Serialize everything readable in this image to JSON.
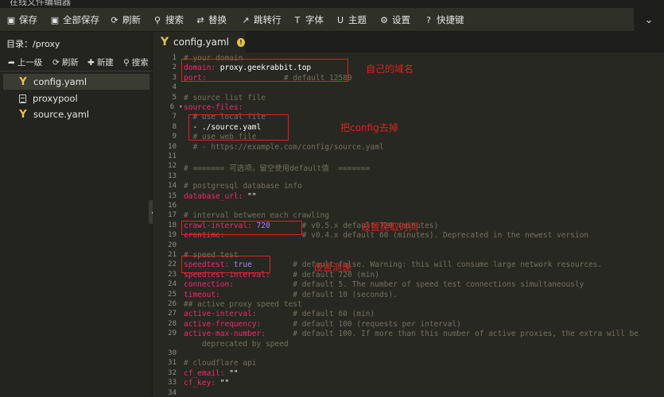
{
  "window": {
    "title": "在线文件编辑器"
  },
  "toolbar": {
    "items": [
      {
        "label": "保存",
        "icon": "save-icon",
        "glyph": "▣"
      },
      {
        "label": "全部保存",
        "icon": "save-all-icon",
        "glyph": "▣"
      },
      {
        "label": "刷新",
        "icon": "refresh-icon",
        "glyph": "⟳"
      },
      {
        "label": "搜索",
        "icon": "search-icon",
        "glyph": "⚲"
      },
      {
        "label": "替换",
        "icon": "replace-icon",
        "glyph": "⇄"
      },
      {
        "label": "跳转行",
        "icon": "goto-line-icon",
        "glyph": "↗"
      },
      {
        "label": "字体",
        "icon": "font-icon",
        "glyph": "T"
      },
      {
        "label": "主题",
        "icon": "theme-icon",
        "glyph": "U"
      },
      {
        "label": "设置",
        "icon": "gear-icon",
        "glyph": "⚙"
      },
      {
        "label": "快捷键",
        "icon": "help-icon",
        "glyph": "?"
      }
    ],
    "collapse_icon": "chevron-down-icon"
  },
  "sidebar": {
    "dir_label": "目录：/proxy",
    "tools": [
      {
        "label": "上一级",
        "icon": "up-arrow-icon",
        "glyph": "➦"
      },
      {
        "label": "刷新",
        "icon": "refresh-icon",
        "glyph": "⟳"
      },
      {
        "label": "新建",
        "icon": "plus-icon",
        "glyph": "✚"
      },
      {
        "label": "搜索",
        "icon": "search-icon",
        "glyph": "⚲"
      }
    ],
    "files": [
      {
        "name": "config.yaml",
        "type": "yaml",
        "selected": true
      },
      {
        "name": "proxypool",
        "type": "file",
        "selected": false
      },
      {
        "name": "source.yaml",
        "type": "yaml",
        "selected": false
      }
    ]
  },
  "tab": {
    "label": "config.yaml",
    "badge": "!"
  },
  "editor": {
    "lines": [
      {
        "n": "1",
        "fold": false,
        "segs": [
          [
            "c",
            "# your domain"
          ]
        ]
      },
      {
        "n": "2",
        "fold": false,
        "segs": [
          [
            "k",
            "domain:"
          ],
          [
            "s",
            " proxy.geekrabbit.top"
          ]
        ]
      },
      {
        "n": "3",
        "fold": false,
        "segs": [
          [
            "k",
            "port:"
          ],
          [
            "c",
            "                 # default 12580"
          ]
        ]
      },
      {
        "n": "4",
        "fold": false,
        "segs": []
      },
      {
        "n": "5",
        "fold": false,
        "segs": [
          [
            "c",
            "# source list file"
          ]
        ]
      },
      {
        "n": "6",
        "fold": true,
        "segs": [
          [
            "k",
            "source-files:"
          ]
        ]
      },
      {
        "n": "7",
        "fold": false,
        "segs": [
          [
            "c",
            "  # use local file"
          ]
        ]
      },
      {
        "n": "8",
        "fold": false,
        "segs": [
          [
            "s",
            "  - ./source.yaml"
          ]
        ]
      },
      {
        "n": "9",
        "fold": false,
        "segs": [
          [
            "c",
            "  # use web file"
          ]
        ]
      },
      {
        "n": "10",
        "fold": false,
        "segs": [
          [
            "c",
            "  # - https://example.com/config/source.yaml"
          ]
        ]
      },
      {
        "n": "11",
        "fold": false,
        "segs": []
      },
      {
        "n": "12",
        "fold": false,
        "segs": [
          [
            "c",
            "# ======= 可选项，留空使用default值  ======="
          ]
        ]
      },
      {
        "n": "13",
        "fold": false,
        "segs": []
      },
      {
        "n": "14",
        "fold": false,
        "segs": [
          [
            "c",
            "# postgresql database info"
          ]
        ]
      },
      {
        "n": "15",
        "fold": false,
        "segs": [
          [
            "k",
            "database_url:"
          ],
          [
            "s",
            " \"\""
          ]
        ]
      },
      {
        "n": "16",
        "fold": false,
        "segs": []
      },
      {
        "n": "17",
        "fold": false,
        "segs": [
          [
            "c",
            "# interval between each crawling"
          ]
        ]
      },
      {
        "n": "18",
        "fold": false,
        "segs": [
          [
            "k",
            "crawl-interval:"
          ],
          [
            "b",
            " 720"
          ],
          [
            "c",
            "       # v0.5.x default 720 (minutes)"
          ]
        ]
      },
      {
        "n": "19",
        "fold": false,
        "segs": [
          [
            "k",
            "crontime:"
          ],
          [
            "c",
            "                 # v0.4.x default 60 (minutes). Deprecated in the newest version"
          ]
        ]
      },
      {
        "n": "20",
        "fold": false,
        "segs": []
      },
      {
        "n": "21",
        "fold": false,
        "segs": [
          [
            "c",
            "# speed test"
          ]
        ]
      },
      {
        "n": "22",
        "fold": false,
        "segs": [
          [
            "k",
            "speedtest:"
          ],
          [
            "b",
            " true"
          ],
          [
            "c",
            "         # default false. Warning: this will consume large network resources."
          ]
        ]
      },
      {
        "n": "23",
        "fold": false,
        "segs": [
          [
            "k",
            "speedtest-interval:"
          ],
          [
            "c",
            "     # default 720 (min)"
          ]
        ]
      },
      {
        "n": "24",
        "fold": false,
        "segs": [
          [
            "k",
            "connection:"
          ],
          [
            "c",
            "             # default 5. The number of speed test connections simultaneously"
          ]
        ]
      },
      {
        "n": "25",
        "fold": false,
        "segs": [
          [
            "k",
            "timeout:"
          ],
          [
            "c",
            "                # default 10 (seconds)."
          ]
        ]
      },
      {
        "n": "26",
        "fold": false,
        "segs": [
          [
            "c",
            "## active proxy speed test"
          ]
        ]
      },
      {
        "n": "27",
        "fold": false,
        "segs": [
          [
            "k",
            "active-interval:"
          ],
          [
            "c",
            "        # default 60 (min)"
          ]
        ]
      },
      {
        "n": "28",
        "fold": false,
        "segs": [
          [
            "k",
            "active-frequency:"
          ],
          [
            "c",
            "       # default 100 (requests per interval)"
          ]
        ]
      },
      {
        "n": "29",
        "fold": false,
        "segs": [
          [
            "k",
            "active-max-number:"
          ],
          [
            "c",
            "      # default 100. If more than this number of active proxies, the extra will be"
          ]
        ]
      },
      {
        "n": "",
        "fold": false,
        "segs": [
          [
            "c",
            "    deprecated by speed"
          ]
        ]
      },
      {
        "n": "30",
        "fold": false,
        "segs": []
      },
      {
        "n": "31",
        "fold": false,
        "segs": [
          [
            "c",
            "# cloudflare api"
          ]
        ]
      },
      {
        "n": "32",
        "fold": false,
        "segs": [
          [
            "k",
            "cf_email:"
          ],
          [
            "s",
            " \"\""
          ]
        ]
      },
      {
        "n": "33",
        "fold": false,
        "segs": [
          [
            "k",
            "cf_key:"
          ],
          [
            "s",
            " \"\""
          ]
        ]
      },
      {
        "n": "34",
        "fold": false,
        "segs": []
      }
    ]
  },
  "annotations": [
    {
      "text": "自己的域名"
    },
    {
      "text": "把config去掉"
    },
    {
      "text": "设置爬取时间"
    },
    {
      "text": "设置测速"
    }
  ],
  "colors": {
    "annotation": "#e02020",
    "keyword": "#f92672",
    "comment": "#75715e",
    "number": "#ae81ff",
    "background": "#272822"
  }
}
